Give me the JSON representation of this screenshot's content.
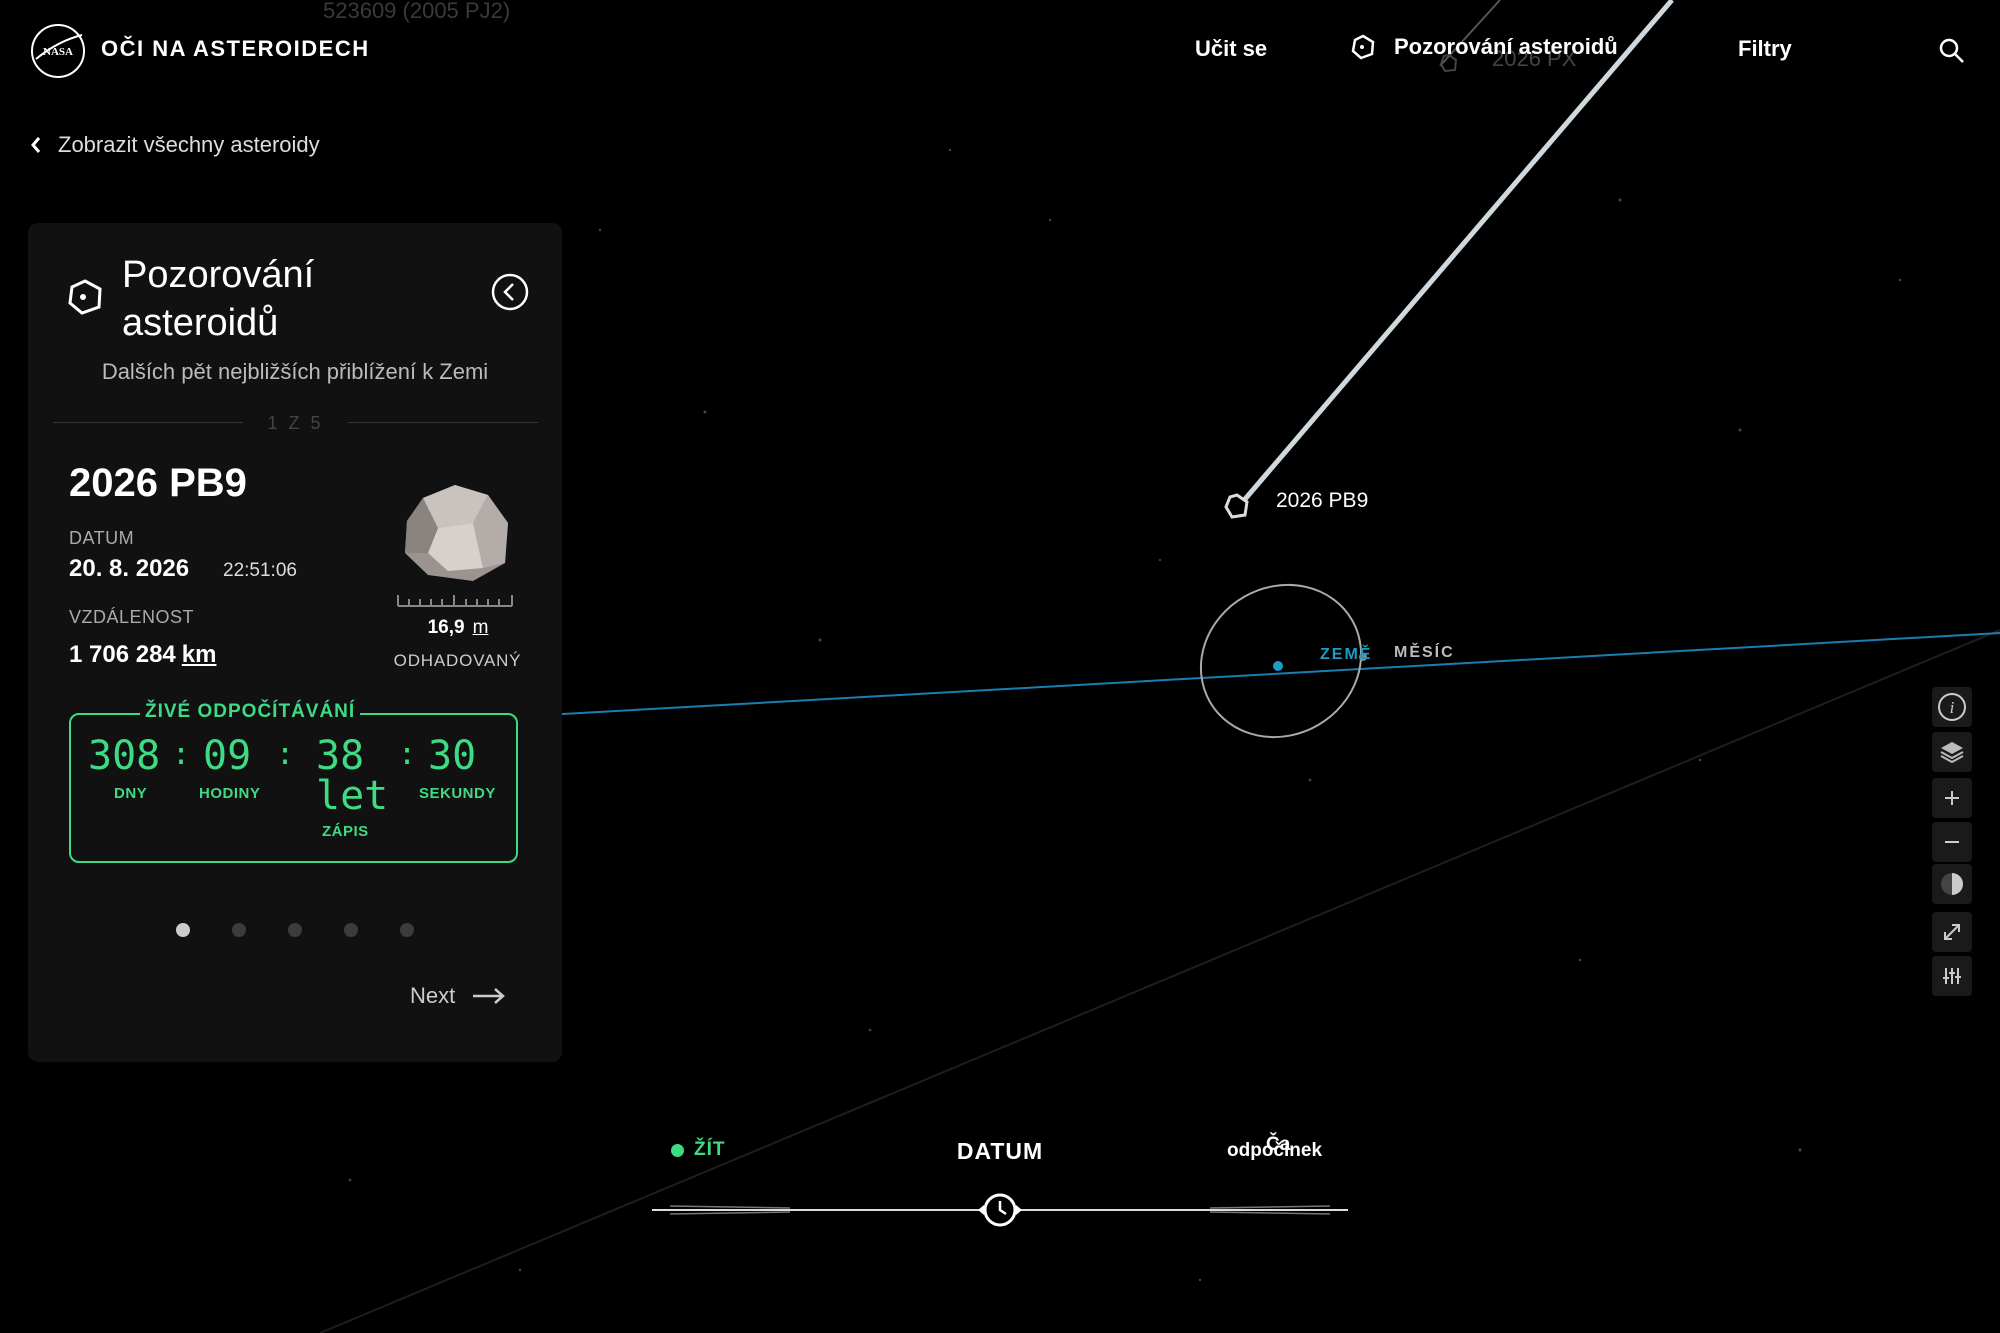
{
  "header": {
    "site_title": "OČI NA ASTEROIDECH",
    "nav": {
      "learn": "Učit se",
      "watch": "Pozorování asteroidů",
      "filters": "Filtry"
    }
  },
  "back_link": "Zobrazit všechny asteroidy",
  "ghost_labels": {
    "top": "523609 (2005 PJ2)",
    "px": "2026 PX"
  },
  "panel": {
    "title": "Pozorování asteroidů",
    "subtitle": "Dalších pět nejbližších přiblížení k Zemi",
    "counter": "1 Z 5",
    "asteroid": {
      "name": "2026 PB9",
      "date_label": "DATUM",
      "date": "20. 8. 2026",
      "time": "22:51:06",
      "distance_label": "VZDÁLENOST",
      "distance_value": "1 706 284",
      "distance_unit": "km",
      "size_value": "16,9",
      "size_unit": "m",
      "size_label": "ODHADOVANÝ"
    },
    "countdown": {
      "title": "ŽIVÉ ODPOČÍTÁVÁNÍ",
      "days": "308",
      "days_label": "DNY",
      "hours": "09",
      "hours_label": "HODINY",
      "minutes": "38",
      "minutes_overlay": "let",
      "minutes_label": "ZÁPIS",
      "seconds": "30",
      "seconds_label": "SEKUNDY"
    },
    "pagination": {
      "total": 5,
      "active": 1
    },
    "next_label": "Next"
  },
  "map": {
    "asteroid_label": "2026 PB9",
    "earth_label": "ZEMĚ",
    "moon_label": "MĚSÍC"
  },
  "timeline": {
    "live_label": "ŽÍT",
    "date_label": "DATUM",
    "speed_label": "odpočinek",
    "speed_overlay": "Ča"
  },
  "colors": {
    "accent_green": "#3ddc84",
    "earth_blue": "#1a9cc4",
    "panel_bg": "#111112"
  },
  "icons": {
    "tools": [
      "info-icon",
      "layers-icon",
      "zoom-in-icon",
      "zoom-out-icon",
      "lighting-icon",
      "fullscreen-icon",
      "settings-icon"
    ]
  }
}
